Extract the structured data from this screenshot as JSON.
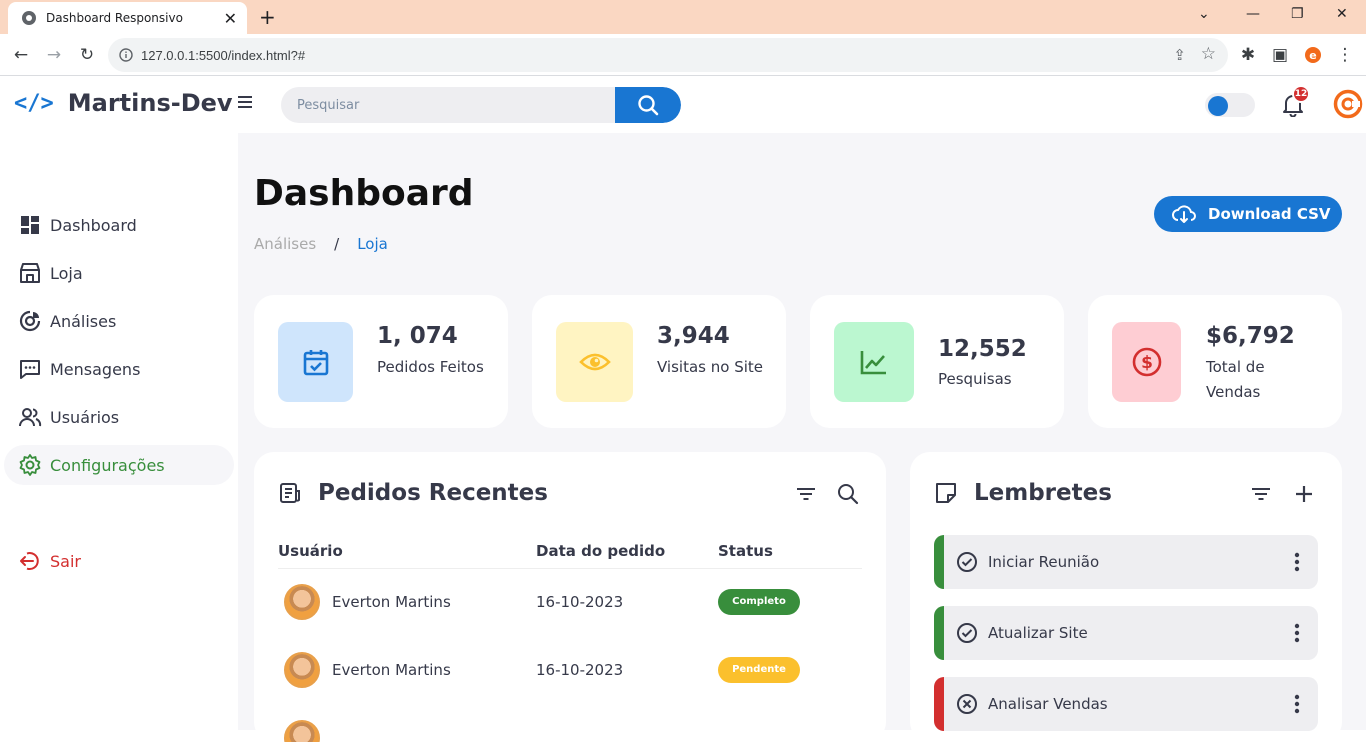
{
  "browser": {
    "tab_title": "Dashboard Responsivo",
    "url": "127.0.0.1:5500/index.html?#"
  },
  "app": {
    "brand": "Martins-Dev",
    "search_placeholder": "Pesquisar",
    "notification_count": "12",
    "accent": "#1976d2"
  },
  "sidebar": {
    "items": [
      {
        "label": "Dashboard",
        "icon": "dashboard-icon"
      },
      {
        "label": "Loja",
        "icon": "store-icon"
      },
      {
        "label": "Análises",
        "icon": "analytics-icon"
      },
      {
        "label": "Mensagens",
        "icon": "message-icon"
      },
      {
        "label": "Usuários",
        "icon": "users-icon"
      },
      {
        "label": "Configurações",
        "icon": "settings-icon",
        "active": true
      }
    ],
    "logout": "Sair"
  },
  "header": {
    "title": "Dashboard",
    "breadcrumb": [
      "Análises",
      "/",
      "Loja"
    ],
    "download_label": "Download CSV"
  },
  "stats": [
    {
      "value": "1, 074",
      "label": "Pedidos Feitos",
      "icon": "calendar-check-icon",
      "color": "#1976d2",
      "bg": "#cfe5fc"
    },
    {
      "value": "3,944",
      "label": "Visitas no Site",
      "icon": "eye-icon",
      "color": "#fbc02d",
      "bg": "#fff4c2"
    },
    {
      "value": "12,552",
      "label": "Pesquisas",
      "icon": "line-chart-icon",
      "color": "#388e3c",
      "bg": "#bbf7d0"
    },
    {
      "value": "$6,792",
      "label": "Total de Vendas",
      "icon": "dollar-circle-icon",
      "color": "#d32f2f",
      "bg": "#fecdd3"
    }
  ],
  "orders": {
    "title": "Pedidos Recentes",
    "columns": [
      "Usuário",
      "Data do pedido",
      "Status"
    ],
    "rows": [
      {
        "user": "Everton Martins",
        "date": "16-10-2023",
        "status": "Completo",
        "status_type": "done"
      },
      {
        "user": "Everton Martins",
        "date": "16-10-2023",
        "status": "Pendente",
        "status_type": "pending"
      }
    ]
  },
  "reminders": {
    "title": "Lembretes",
    "items": [
      {
        "label": "Iniciar Reunião",
        "state": "completed",
        "color": "#388e3c"
      },
      {
        "label": "Atualizar Site",
        "state": "completed",
        "color": "#388e3c"
      },
      {
        "label": "Analisar Vendas",
        "state": "not-completed",
        "color": "#d32f2f"
      }
    ]
  }
}
